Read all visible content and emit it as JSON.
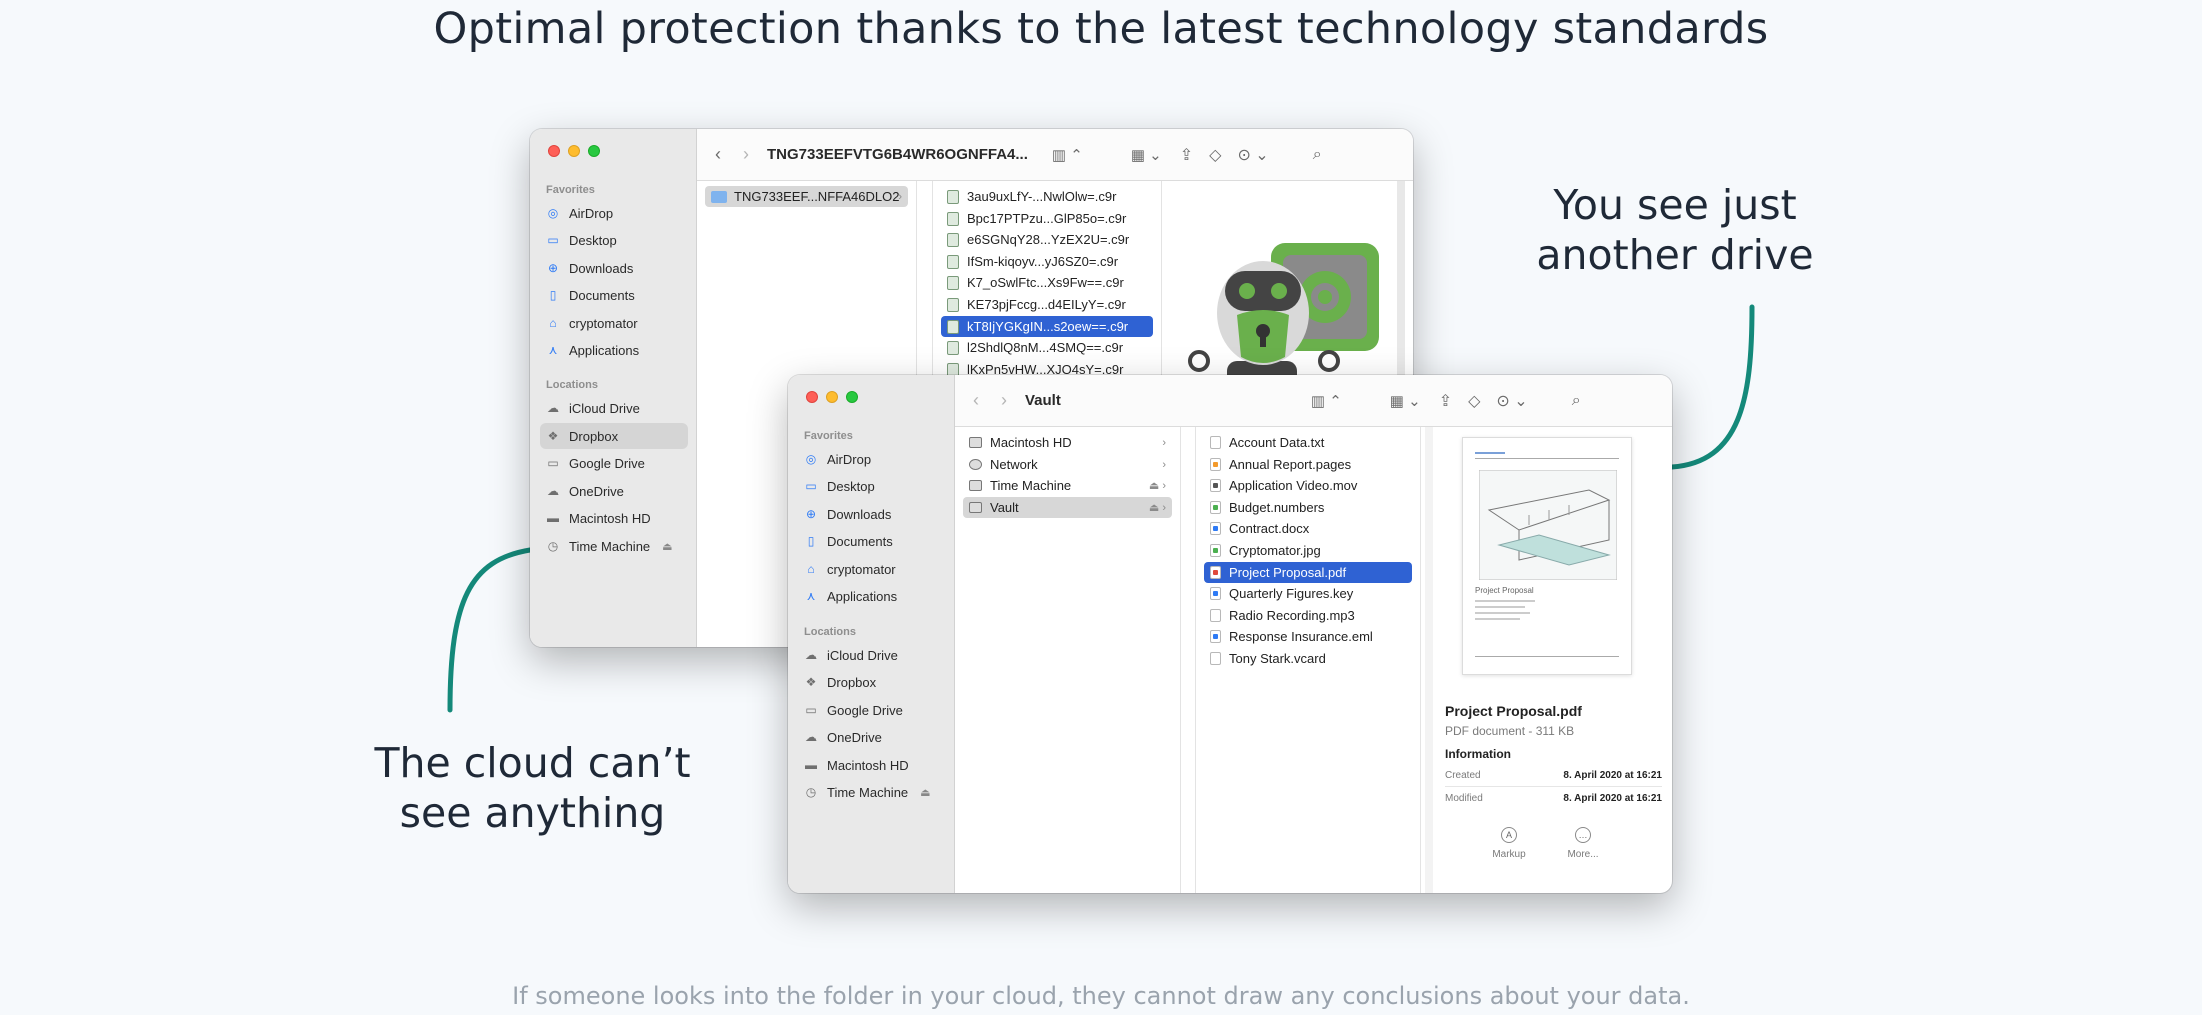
{
  "headline": "Optimal protection thanks to the latest technology standards",
  "callouts": {
    "right": [
      "You see just",
      "another drive"
    ],
    "left": [
      "The cloud can’t",
      "see anything"
    ]
  },
  "footer": "If someone looks into the folder in your cloud, they cannot draw any conclusions about your data.",
  "back_window": {
    "title": "TNG733EEFVTG6B4WR6OGNFFA4...",
    "sidebar": {
      "favorites_label": "Favorites",
      "favorites": [
        "AirDrop",
        "Desktop",
        "Downloads",
        "Documents",
        "cryptomator",
        "Applications"
      ],
      "locations_label": "Locations",
      "locations": [
        "iCloud Drive",
        "Dropbox",
        "Google Drive",
        "OneDrive",
        "Macintosh HD",
        "Time Machine"
      ],
      "selected": "Dropbox"
    },
    "column1": [
      "TNG733EEF...NFFA46DLO2"
    ],
    "column2": [
      "3au9uxLfY-...NwlOlw=.c9r",
      "Bpc17PTPzu...GlP85o=.c9r",
      "e6SGNqY28...YzEX2U=.c9r",
      "IfSm-kiqoyv...yJ6SZ0=.c9r",
      "K7_oSwlFtc...Xs9Fw==.c9r",
      "KE73pjFccg...d4EILyY=.c9r",
      "kT8IjYGKgIN...s2oew==.c9r",
      "l2ShdlQ8nM...4SMQ==.c9r",
      "lKxPn5vHW...XJO4sY=.c9r"
    ],
    "selected_file": "kT8IjYGKgIN...s2oew==.c9r"
  },
  "front_window": {
    "title": "Vault",
    "sidebar": {
      "favorites_label": "Favorites",
      "favorites": [
        "AirDrop",
        "Desktop",
        "Downloads",
        "Documents",
        "cryptomator",
        "Applications"
      ],
      "locations_label": "Locations",
      "locations": [
        "iCloud Drive",
        "Dropbox",
        "Google Drive",
        "OneDrive",
        "Macintosh HD",
        "Time Machine"
      ]
    },
    "column1": [
      "Macintosh HD",
      "Network",
      "Time Machine",
      "Vault"
    ],
    "column2": [
      "Account Data.txt",
      "Annual Report.pages",
      "Application Video.mov",
      "Budget.numbers",
      "Contract.docx",
      "Cryptomator.jpg",
      "Project Proposal.pdf",
      "Quarterly Figures.key",
      "Radio Recording.mp3",
      "Response Insurance.eml",
      "Tony Stark.vcard"
    ],
    "selected_file": "Project Proposal.pdf",
    "preview": {
      "doc_title": "Project Proposal",
      "name": "Project Proposal.pdf",
      "kind": "PDF document - 311 KB",
      "information_label": "Information",
      "created_label": "Created",
      "created_value": "8. April 2020 at 16:21",
      "modified_label": "Modified",
      "modified_value": "8. April 2020 at 16:21",
      "markup_label": "Markup",
      "more_label": "More..."
    }
  },
  "colors": {
    "accent_green": "#14897a",
    "selection_blue": "#2f62d3",
    "robot_green": "#6ab04c"
  },
  "icons": [
    "back-chevron-icon",
    "forward-chevron-icon",
    "column-view-icon",
    "group-icon",
    "share-icon",
    "tag-icon",
    "more-actions-icon",
    "search-icon"
  ]
}
